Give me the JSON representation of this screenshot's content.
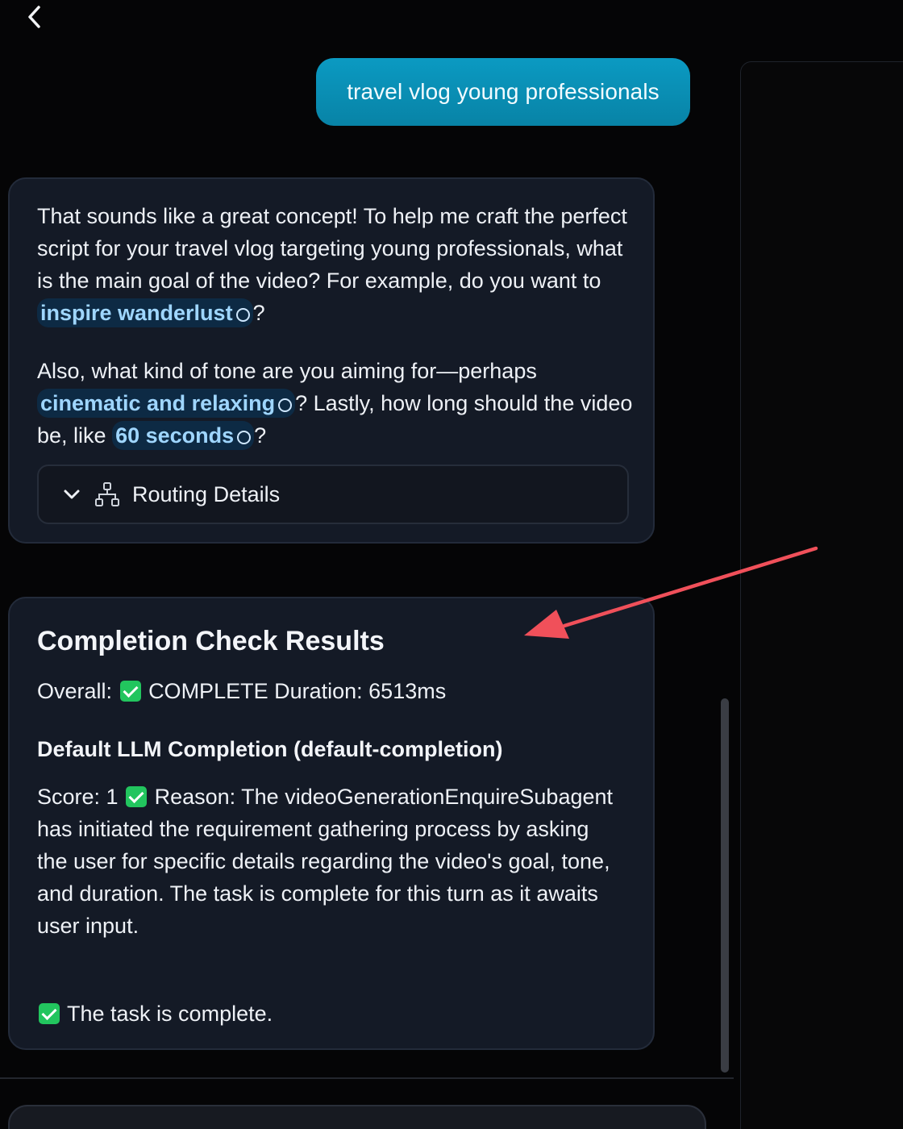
{
  "nav": {
    "back_icon": "chevron-left-icon"
  },
  "user_message": {
    "text": "travel vlog young professionals"
  },
  "assistant_message": {
    "para1_before": "That sounds like a great concept! To help me craft the perfect script for your travel vlog targeting young professionals, what is the main goal of the video? For example, do you want to ",
    "chip1": "inspire wanderlust",
    "para1_after": "?",
    "para2_before": "Also, what kind of tone are you aiming for—perhaps ",
    "chip2": "cinematic and relaxing",
    "para2_middle": "? Lastly, how long should the video be, like ",
    "chip3": "60 seconds",
    "para2_after": "?",
    "routing_label": "Routing Details",
    "routing_icons": [
      "chevron-down-icon",
      "hierarchy-icon"
    ]
  },
  "completion_check": {
    "title": "Completion Check Results",
    "overall_label": "Overall:",
    "overall_status": "COMPLETE",
    "duration_text": "Duration: 6513ms",
    "subtitle": "Default LLM Completion (default-completion)",
    "score_label": "Score: 1",
    "reason_text": "Reason: The videoGenerationEnquireSubagent has initiated the requirement gathering process by asking the user for specific details regarding the video's goal, tone, and duration. The task is complete for this turn as it awaits user input.",
    "final_text": "The task is complete.",
    "check_icon": "check-mark-icon"
  },
  "colors": {
    "background": "#050506",
    "card": "#141a26",
    "user_bubble": "#0b9ac2",
    "chip_bg": "#0d2a44",
    "chip_text": "#9fd6ff",
    "check_green": "#22c55e",
    "annotation_arrow": "#f0505a"
  }
}
